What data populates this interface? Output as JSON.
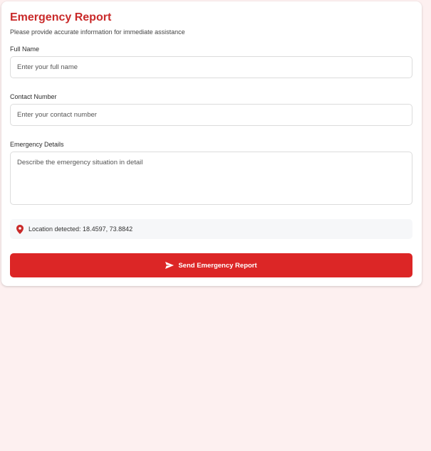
{
  "form": {
    "title": "Emergency Report",
    "subtitle": "Please provide accurate information for immediate assistance",
    "full_name": {
      "label": "Full Name",
      "value": "",
      "placeholder": "Enter your full name"
    },
    "contact_number": {
      "label": "Contact Number",
      "value": "",
      "placeholder": "Enter your contact number"
    },
    "emergency_details": {
      "label": "Emergency Details",
      "value": "",
      "placeholder": "Describe the emergency situation in detail"
    },
    "location": {
      "icon": "map-pin-icon",
      "text": "Location detected: 18.4597, 73.8842"
    },
    "submit": {
      "icon": "send-icon",
      "label": "Send Emergency Report"
    }
  },
  "colors": {
    "accent": "#dc2626",
    "title": "#c92a2a",
    "page_background": "#fdf0f0"
  }
}
